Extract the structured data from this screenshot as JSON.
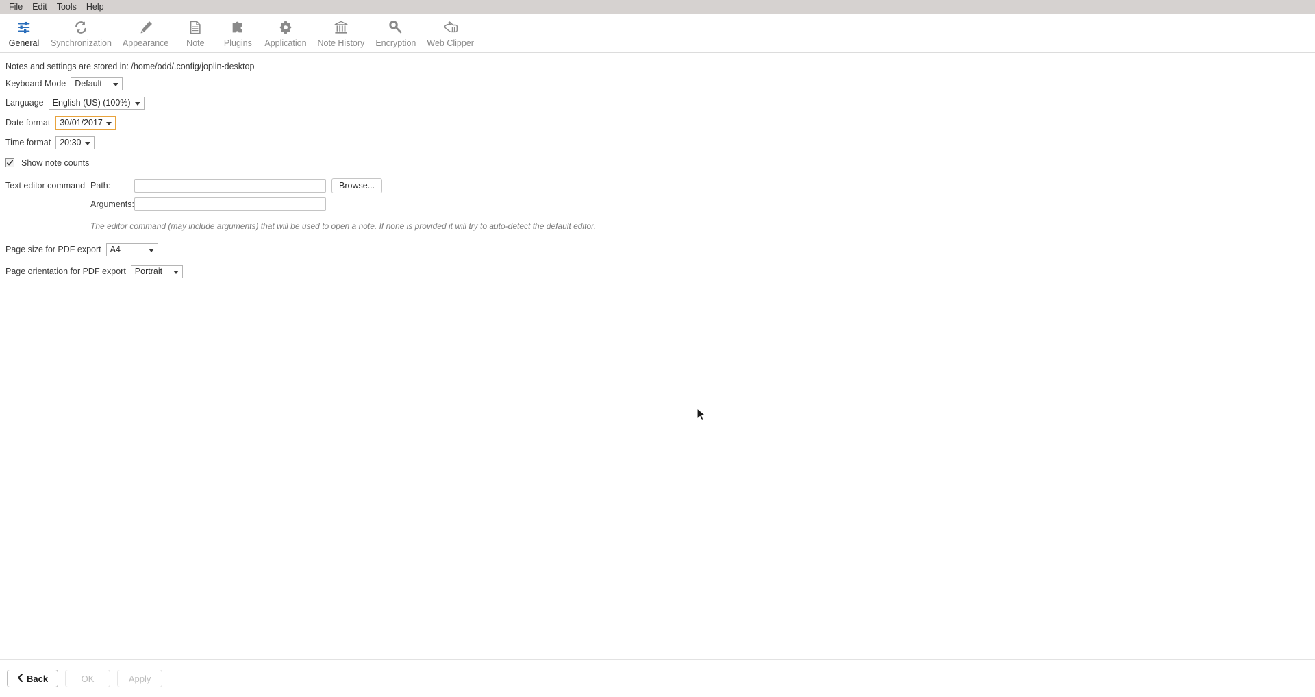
{
  "menubar": {
    "items": [
      {
        "label": "File"
      },
      {
        "label": "Edit"
      },
      {
        "label": "Tools"
      },
      {
        "label": "Help"
      }
    ]
  },
  "tabs": {
    "active": "General",
    "items": [
      {
        "label": "General",
        "icon": "sliders-icon",
        "active": true
      },
      {
        "label": "Synchronization",
        "icon": "sync-icon",
        "active": false
      },
      {
        "label": "Appearance",
        "icon": "pencil-icon",
        "active": false
      },
      {
        "label": "Note",
        "icon": "document-icon",
        "active": false
      },
      {
        "label": "Plugins",
        "icon": "puzzle-piece-icon",
        "active": false
      },
      {
        "label": "Application",
        "icon": "gear-icon",
        "active": false
      },
      {
        "label": "Note History",
        "icon": "bank-icon",
        "active": false
      },
      {
        "label": "Encryption",
        "icon": "key-icon",
        "active": false
      },
      {
        "label": "Web Clipper",
        "icon": "web-clipper-icon",
        "active": false
      }
    ]
  },
  "settings": {
    "storage_notice": "Notes and settings are stored in: /home/odd/.config/joplin-desktop",
    "keyboard_mode": {
      "label": "Keyboard Mode",
      "value": "Default"
    },
    "language": {
      "label": "Language",
      "value": "English (US) (100%)"
    },
    "date_format": {
      "label": "Date format",
      "value": "30/01/2017",
      "focused": true
    },
    "time_format": {
      "label": "Time format",
      "value": "20:30"
    },
    "show_note_counts": {
      "label": "Show note counts",
      "checked": true
    },
    "text_editor_command": {
      "label": "Text editor command",
      "path_label": "Path:",
      "path_value": "",
      "arguments_label": "Arguments:",
      "arguments_value": "",
      "browse_label": "Browse...",
      "help": "The editor command (may include arguments) that will be used to open a note. If none is provided it will try to auto-detect the default editor."
    },
    "pdf_page_size": {
      "label": "Page size for PDF export",
      "value": "A4"
    },
    "pdf_page_orientation": {
      "label": "Page orientation for PDF export",
      "value": "Portrait"
    }
  },
  "footer": {
    "back_label": "Back",
    "ok_label": "OK",
    "apply_label": "Apply"
  },
  "colors": {
    "focus_outline": "#e8a33d",
    "active_tab_icon": "#2a6ebb",
    "menubar_bg": "#d6d2d0",
    "inactive_icon": "#8a8a8a"
  }
}
